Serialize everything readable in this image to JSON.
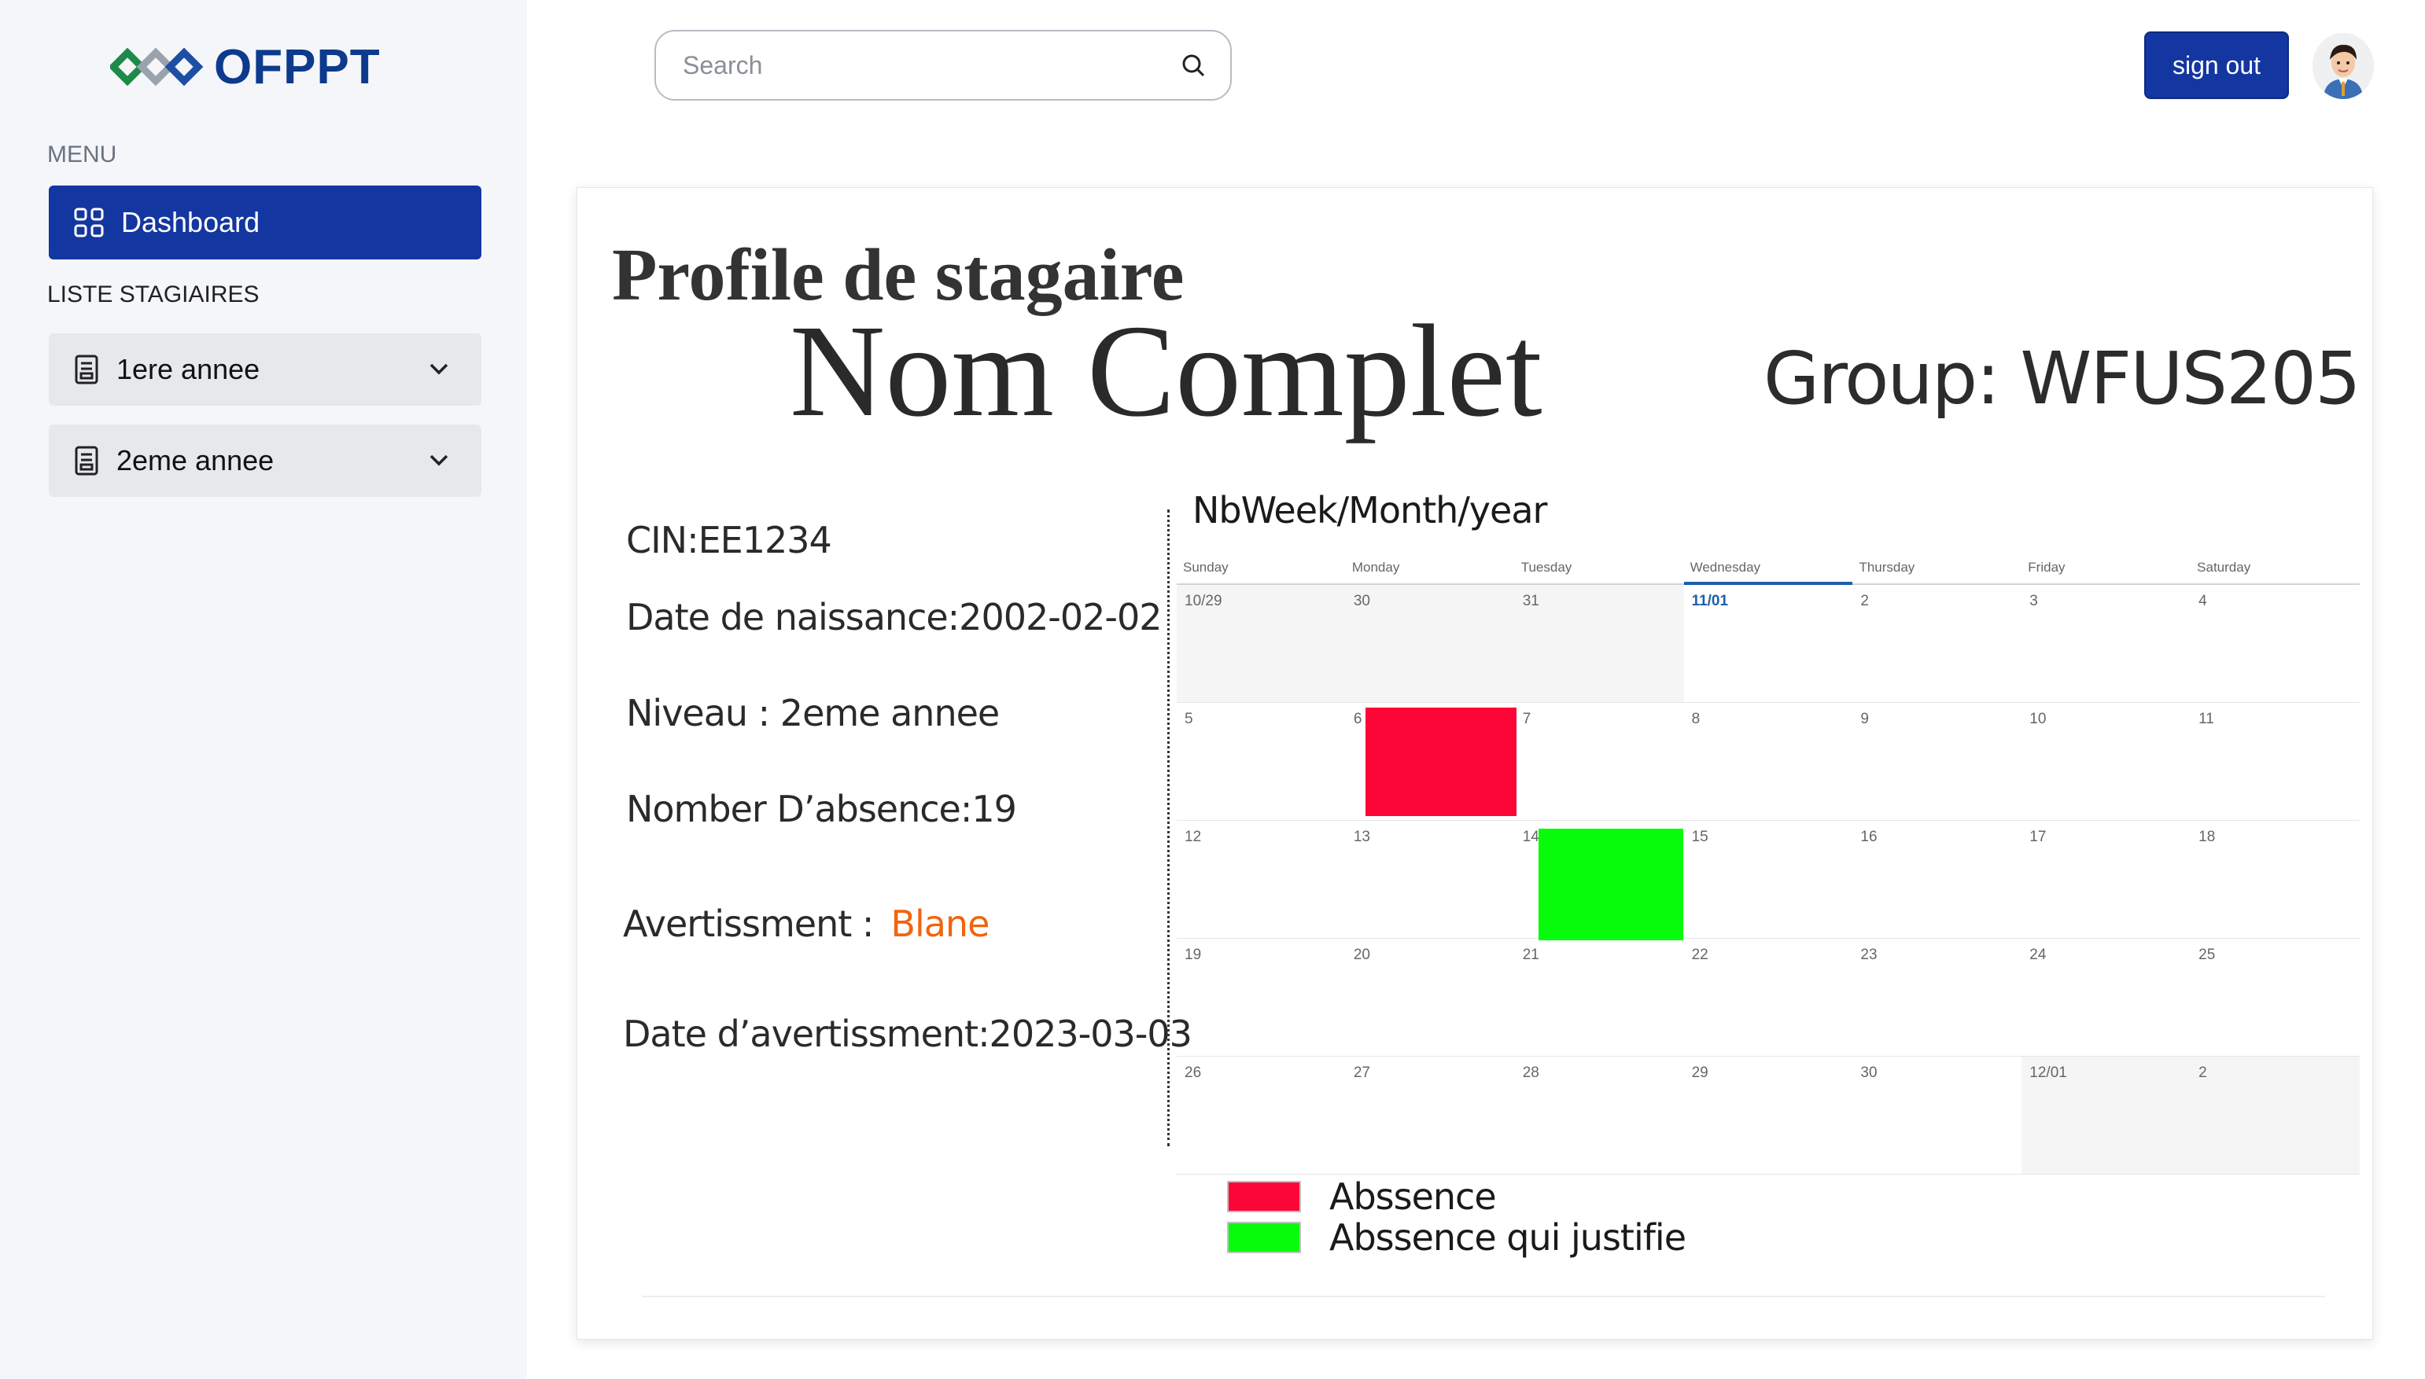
{
  "brand": {
    "name": "OFPPT"
  },
  "sidebar": {
    "menu_label": "MENU",
    "dashboard_label": "Dashboard",
    "liste_label": "LISTE STAGIAIRES",
    "items": [
      {
        "label": "1ere annee"
      },
      {
        "label": "2eme annee"
      }
    ]
  },
  "header": {
    "search_placeholder": "Search",
    "signout_label": "sign out"
  },
  "profile": {
    "title": "Profile de stagaire",
    "full_name": "Nom Complet",
    "group": "Group: WFUS205",
    "cin": "CIN:EE1234",
    "birth_date": "Date de naissance:2002-02-02",
    "niveau": "Niveau : 2eme annee",
    "absences": "Nomber D’absence:19",
    "warning_label": "Avertissment :",
    "warning_value": "Blane",
    "warning_date": "Date d’avertissment:2023-03-03"
  },
  "calendar": {
    "title": "NbWeek/Month/year",
    "weekdays": [
      "Sunday",
      "Monday",
      "Tuesday",
      "Wednesday",
      "Thursday",
      "Friday",
      "Saturday"
    ],
    "active_weekday": "Wednesday",
    "weeks": [
      [
        "10/29",
        "30",
        "31",
        "11/01",
        "2",
        "3",
        "4"
      ],
      [
        "5",
        "6",
        "7",
        "8",
        "9",
        "10",
        "11"
      ],
      [
        "12",
        "13",
        "14",
        "15",
        "16",
        "17",
        "18"
      ],
      [
        "19",
        "20",
        "21",
        "22",
        "23",
        "24",
        "25"
      ],
      [
        "26",
        "27",
        "28",
        "29",
        "30",
        "12/01",
        "2"
      ]
    ],
    "absence_color": "#fc0637",
    "justified_color": "#06fc0a"
  },
  "legend": {
    "absence": "Abssence",
    "justified": "Abssence qui justifie"
  }
}
